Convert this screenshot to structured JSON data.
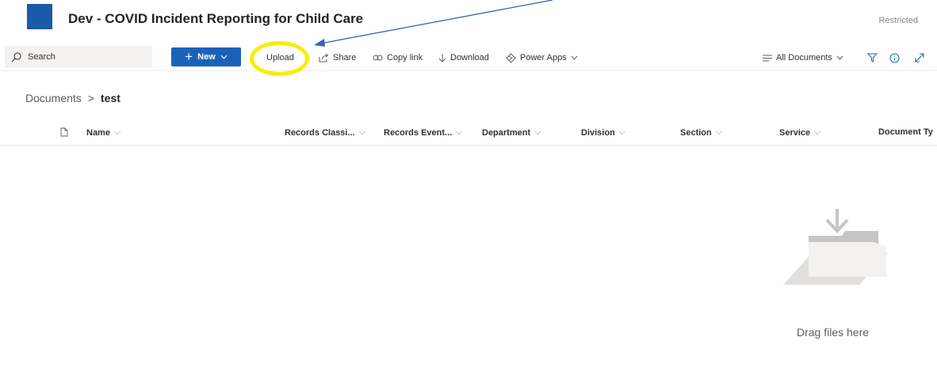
{
  "site": {
    "title": "Dev - COVID Incident Reporting for Child Care",
    "badge": "Restricted",
    "logo_color": "#1a5aa9"
  },
  "search": {
    "placeholder": "Search"
  },
  "commands": {
    "new_label": "New",
    "upload_label": "Upload",
    "share_label": "Share",
    "copylink_label": "Copy link",
    "download_label": "Download",
    "powerapps_label": "Power Apps",
    "view_label": "All Documents"
  },
  "breadcrumb": {
    "root": "Documents",
    "separator": ">",
    "current": "test"
  },
  "columns": [
    "Name",
    "Records Classi...",
    "Records Event...",
    "Department",
    "Division",
    "Section",
    "Service",
    "Document Ty"
  ],
  "empty_state": {
    "text": "Drag files here"
  },
  "colors": {
    "accent": "#1a62b8",
    "highlight": "#f6ef00",
    "arrow": "#3a5fb8"
  },
  "icons": [
    "search-icon",
    "plus-icon",
    "chevron-down-icon",
    "share-icon",
    "copy-link-icon",
    "download-icon",
    "power-apps-icon",
    "view-lines-icon",
    "filter-icon",
    "info-icon",
    "expand-icon",
    "document-icon",
    "folder-icon"
  ]
}
